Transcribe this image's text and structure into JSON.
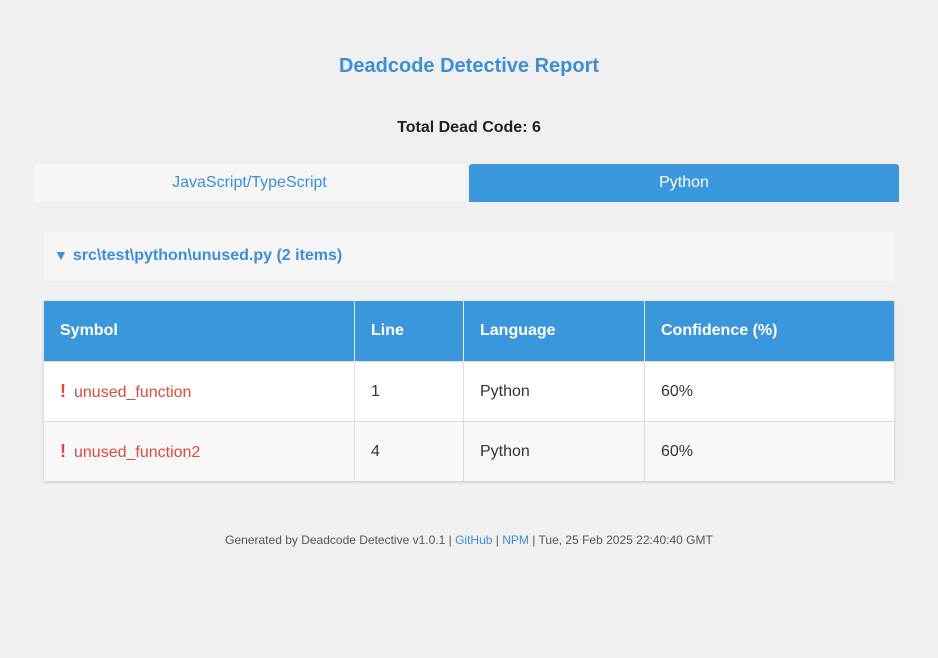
{
  "report": {
    "title": "Deadcode Detective Report",
    "total_label": "Total Dead Code: 6"
  },
  "tabs": [
    {
      "label": "JavaScript/TypeScript",
      "active": false
    },
    {
      "label": "Python",
      "active": true
    }
  ],
  "file_group": {
    "toggle_icon": "▼",
    "label": "src\\test\\python\\unused.py (2 items)"
  },
  "table": {
    "headers": [
      "Symbol",
      "Line",
      "Language",
      "Confidence (%)"
    ],
    "rows": [
      {
        "icon": "!",
        "symbol": "unused_function",
        "line": "1",
        "language": "Python",
        "confidence": "60%"
      },
      {
        "icon": "!",
        "symbol": "unused_function2",
        "line": "4",
        "language": "Python",
        "confidence": "60%"
      }
    ]
  },
  "footer": {
    "prefix": "Generated by Deadcode Detective v1.0.1 |",
    "github": "GitHub",
    "sep": "|",
    "npm": "NPM",
    "suffix": "| Tue, 25 Feb 2025 22:40:40 GMT"
  },
  "colors": {
    "accent": "#3a97dc",
    "link": "#3a8fd6",
    "warning": "#e2443a"
  }
}
